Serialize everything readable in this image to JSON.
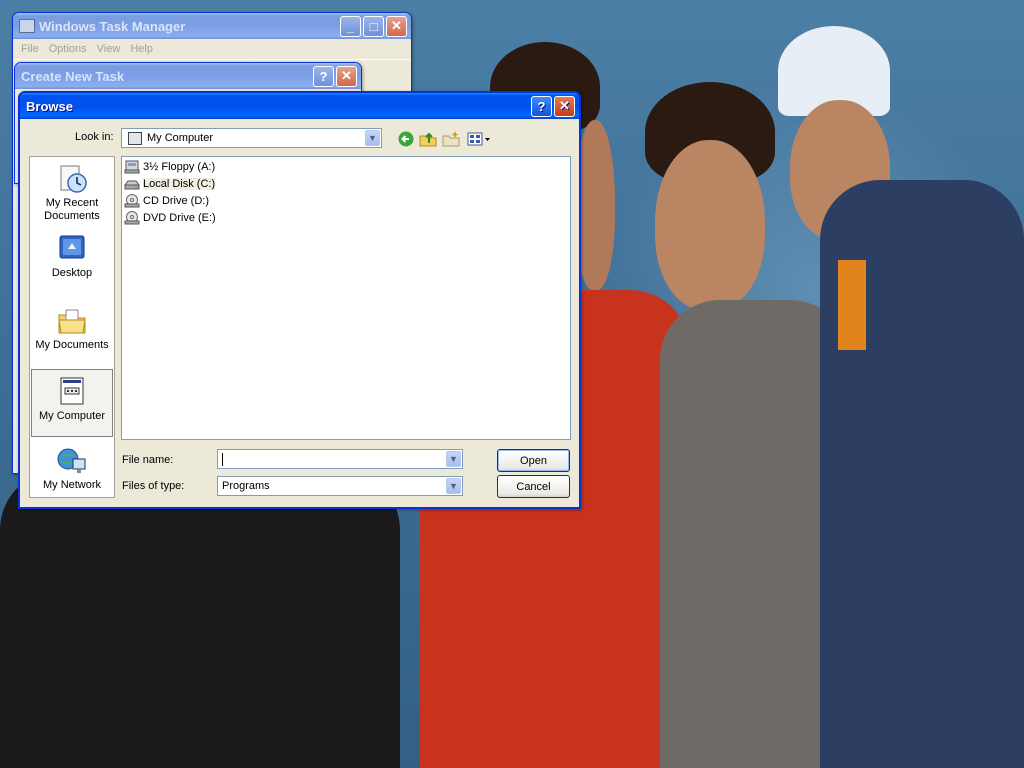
{
  "taskmgr": {
    "title": "Windows Task Manager",
    "menu": [
      "File",
      "Options",
      "View",
      "Help"
    ]
  },
  "createtask": {
    "title": "Create New Task"
  },
  "browse": {
    "title": "Browse",
    "look_in_label": "Look in:",
    "look_in_value": "My Computer",
    "places": [
      {
        "label": "My Recent Documents",
        "icon": "recent-documents-icon"
      },
      {
        "label": "Desktop",
        "icon": "desktop-icon"
      },
      {
        "label": "My Documents",
        "icon": "my-documents-icon"
      },
      {
        "label": "My Computer",
        "icon": "my-computer-icon"
      },
      {
        "label": "My Network",
        "icon": "my-network-icon"
      }
    ],
    "files": [
      {
        "label": "3½ Floppy (A:)",
        "icon": "floppy-drive-icon"
      },
      {
        "label": "Local Disk (C:)",
        "icon": "hard-disk-icon"
      },
      {
        "label": "CD Drive (D:)",
        "icon": "cd-drive-icon"
      },
      {
        "label": "DVD Drive (E:)",
        "icon": "dvd-drive-icon"
      }
    ],
    "file_name_label": "File name:",
    "file_name_value": "",
    "file_type_label": "Files of type:",
    "file_type_value": "Programs",
    "open_label": "Open",
    "cancel_label": "Cancel",
    "help_button": "?",
    "close_button": "✕"
  },
  "caption_buttons": {
    "minimize": "_",
    "maximize": "□",
    "close": "✕",
    "help": "?"
  }
}
